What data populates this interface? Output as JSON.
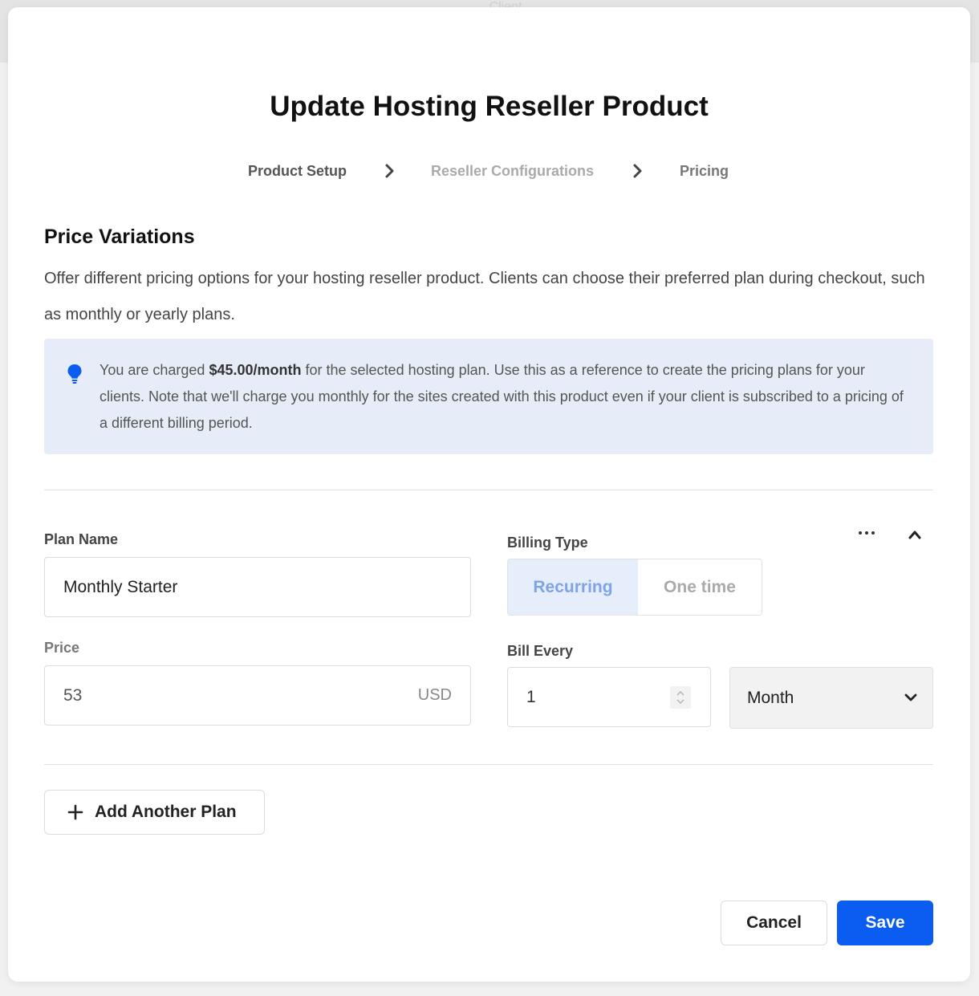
{
  "backdrop": {
    "ghost_text": "Client"
  },
  "modal": {
    "title": "Update Hosting Reseller Product",
    "steps": [
      {
        "label": "Product Setup"
      },
      {
        "label": "Reseller Configurations"
      },
      {
        "label": "Pricing"
      }
    ]
  },
  "section": {
    "title": "Price Variations",
    "description": "Offer different pricing options for your hosting reseller product. Clients can choose their preferred plan during checkout, such as monthly or yearly plans."
  },
  "info": {
    "icon": "lightbulb-icon",
    "text_before": "You are charged ",
    "text_bold": "$45.00/month",
    "text_after": " for the selected hosting plan. Use this as a reference to create the pricing plans for your clients. Note that we'll charge you monthly for the sites created with this product even if your client is subscribed to a pricing of a different billing period."
  },
  "plan": {
    "plan_name_label": "Plan Name",
    "plan_name_value": "Monthly Starter",
    "price_label": "Price",
    "price_value": "53",
    "price_currency": "USD",
    "billing_type_label": "Billing Type",
    "billing_options": [
      "Recurring",
      "One time"
    ],
    "billing_selected": "Recurring",
    "bill_every_label": "Bill Every",
    "bill_every_value": "1",
    "period_value": "Month"
  },
  "actions": {
    "add_plan": "Add Another Plan",
    "cancel": "Cancel",
    "save": "Save"
  },
  "colors": {
    "accent": "#0b5cf0",
    "info_bg": "#e6ecf8",
    "toggle_active_bg": "#e6eefb",
    "toggle_active_text": "#7fa4e6"
  }
}
